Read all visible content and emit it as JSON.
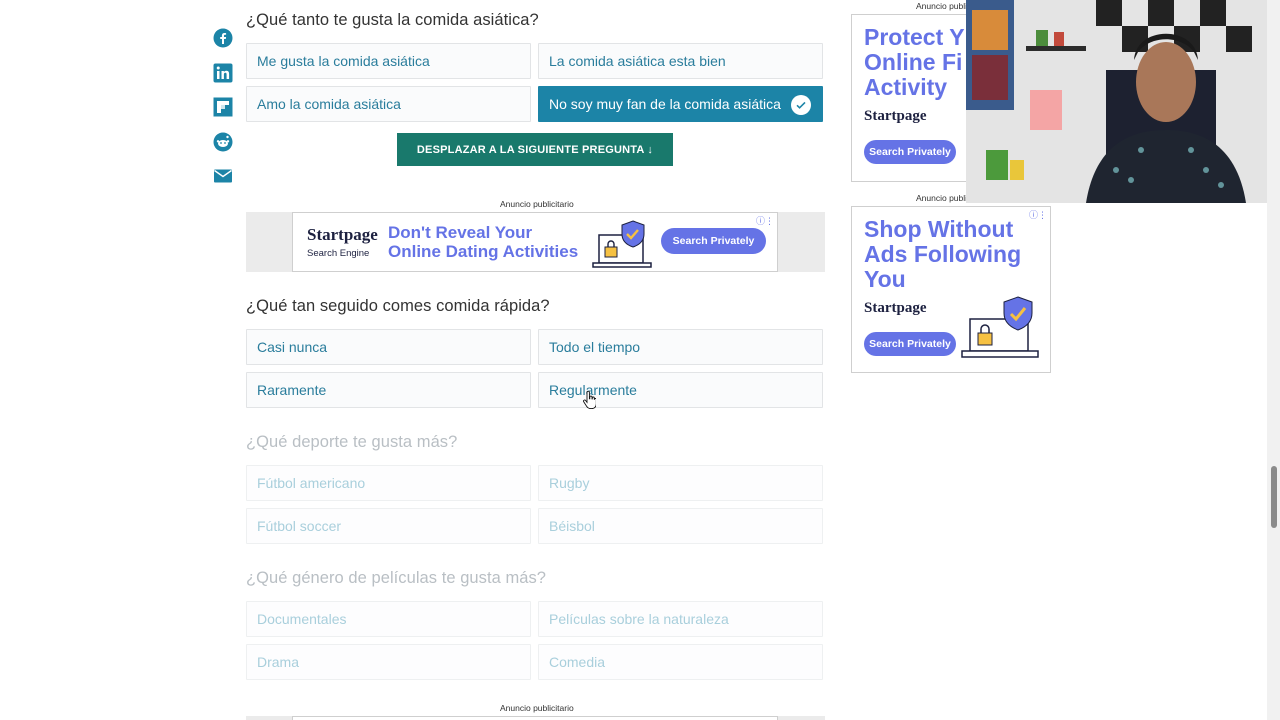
{
  "share_icons": [
    "facebook-icon",
    "linkedin-icon",
    "flipboard-icon",
    "reddit-icon",
    "email-icon"
  ],
  "q1": {
    "title": "¿Qué tanto te gusta la comida asiática?",
    "options": [
      "Me gusta la comida asiática",
      "La comida asiática esta bien",
      "Amo la comida asiática",
      "No soy muy fan de la comida asiática"
    ],
    "selected_index": 3
  },
  "next_button": "DESPLAZAR A LA SIGUIENTE PREGUNTA ↓",
  "ad_label": "Anuncio publicitario",
  "banner_ad": {
    "logo": "Startpage",
    "logo_sub": "Search Engine",
    "headline_1": "Don't Reveal Your",
    "headline_2": "Online Dating Activities",
    "button": "Search Privately"
  },
  "q2": {
    "title": "¿Qué tan seguido comes comida rápida?",
    "options": [
      "Casi nunca",
      "Todo el tiempo",
      "Raramente",
      "Regularmente"
    ]
  },
  "q3": {
    "title": "¿Qué deporte te gusta más?",
    "options": [
      "Fútbol americano",
      "Rugby",
      "Fútbol soccer",
      "Béisbol"
    ]
  },
  "q4": {
    "title": "¿Qué género de películas te gusta más?",
    "options": [
      "Documentales",
      "Películas sobre la naturaleza",
      "Drama",
      "Comedia"
    ]
  },
  "side_ad_1": {
    "label": "Anuncio publi",
    "line_1": "Protect Y",
    "line_2": "Online Fi",
    "line_3": "Activity",
    "logo": "Startpage",
    "button": "Search Privately"
  },
  "side_ad_2": {
    "label": "Anuncio publi",
    "line_1": "Shop Without",
    "line_2": "Ads Following",
    "line_3": "You",
    "logo": "Startpage",
    "button": "Search Privately"
  },
  "colors": {
    "option_text": "#2a7d9c",
    "selected_bg": "#1c84a7",
    "next_button_bg": "#19796c",
    "ad_accent": "#6573e6"
  }
}
